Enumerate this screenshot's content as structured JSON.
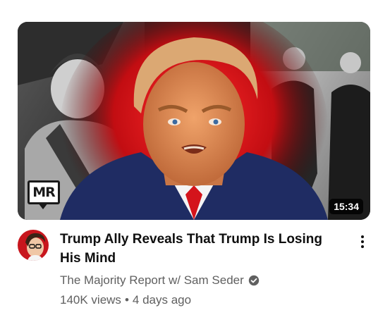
{
  "video": {
    "title": "Trump Ally Reveals That Trump Is Losing His Mind",
    "duration": "15:34",
    "thumbnail_logo_text": "MR",
    "channel": {
      "name": "The Majority Report w/ Sam Seder",
      "verified_icon": "verified-check-icon"
    },
    "views": "140K views",
    "separator": "•",
    "published": "4 days ago"
  },
  "icons": {
    "more": "more-vertical-icon",
    "avatar": "channel-avatar"
  },
  "colors": {
    "title": "#0f0f0f",
    "secondary_text": "#606060",
    "duration_badge_bg": "#000000",
    "thumbnail_glow": "#e3121b",
    "avatar_bg": "#c8161d"
  }
}
